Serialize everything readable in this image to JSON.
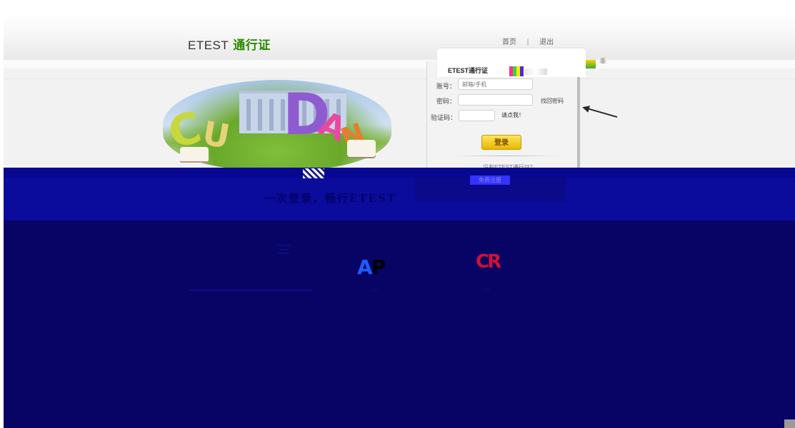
{
  "header": {
    "logo_text": "ETEST",
    "logo_brand": "通行证",
    "nav_home": "首页",
    "nav_separator": "|",
    "nav_logout": "退出"
  },
  "login": {
    "title": "ETEST通行证",
    "account_label": "账号：",
    "account_placeholder": "邮箱/手机",
    "password_label": "密码：",
    "forgot_password": "找回密码",
    "captcha_label": "验证码：",
    "captcha_click": "请点我！",
    "submit": "登录",
    "register_question": "没有ETEST通行证？",
    "register_button": "免费注册"
  },
  "banner": {
    "slogan": "一次登录，畅行ETEST"
  },
  "partners": [
    {
      "logo_text": "AP",
      "label": "AP"
    },
    {
      "logo_text": "CR",
      "label": "CR"
    }
  ],
  "colors": {
    "brand_green": "#2b8a00",
    "band_blue": "#0b0b9c",
    "dark_navy": "#080466",
    "button_yellow": "#ffd633"
  }
}
